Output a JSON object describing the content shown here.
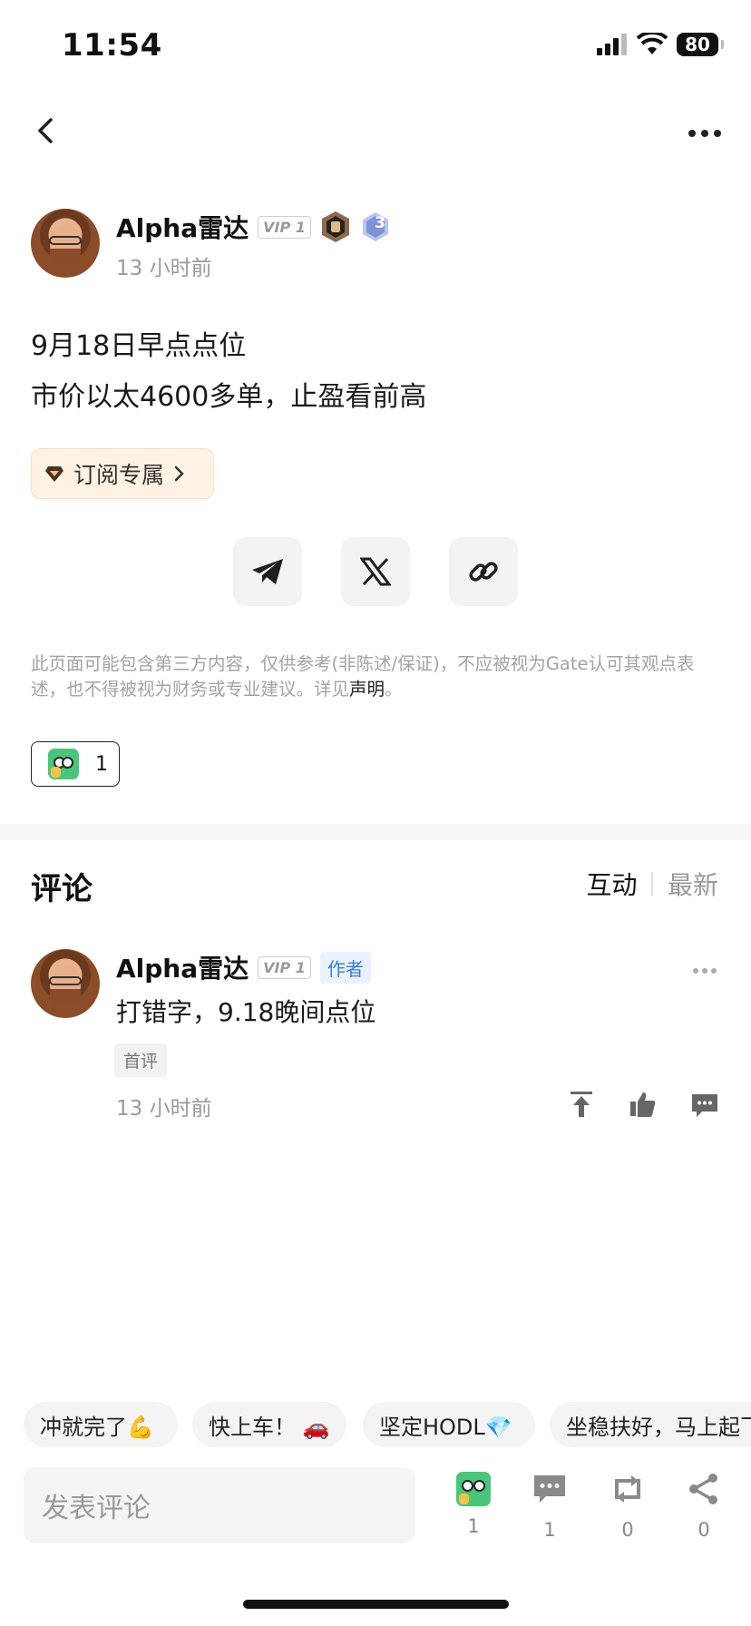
{
  "status_bar": {
    "time": "11:54",
    "battery": "80"
  },
  "post": {
    "author": {
      "name": "Alpha雷达",
      "vip": "VIP 1",
      "level": "3"
    },
    "time_ago": "13 小时前",
    "lines": [
      "9月18日早点点位",
      "市价以太4600多单，止盈看前高"
    ],
    "subscribe_label": "订阅专属",
    "disclaimer_text": "此页面可能包含第三方内容，仅供参考(非陈述/保证)，不应被视为Gate认可其观点表述，也不得被视为财务或专业建议。详见",
    "disclaimer_link": "声明",
    "disclaimer_end": "。",
    "reaction_count": "1"
  },
  "comments": {
    "title": "评论",
    "sort_active": "互动",
    "sort_other": "最新",
    "items": [
      {
        "author": "Alpha雷达",
        "vip": "VIP 1",
        "author_tag": "作者",
        "text": "打错字，9.18晚间点位",
        "tag": "首评",
        "time_ago": "13 小时前"
      }
    ]
  },
  "quick_replies": [
    "冲就完了💪",
    "快上车！ 🚗",
    "坚定HODL💎",
    "坐稳扶好，马上起飞"
  ],
  "bottom_bar": {
    "placeholder": "发表评论",
    "counts": {
      "reaction": "1",
      "comment": "1",
      "repost": "0",
      "share": "0"
    }
  },
  "colors": {
    "accent_blue": "#3a7be0",
    "subscribe_bg": "#fdf2e3",
    "vip_gray": "#9a9a9a"
  },
  "icons": [
    "back-icon",
    "more-icon",
    "telegram-icon",
    "x-icon",
    "link-icon",
    "diamond-icon",
    "chevron-right-icon",
    "pin-top-icon",
    "thumbs-up-icon",
    "comment-icon",
    "repost-icon",
    "share-icon"
  ]
}
